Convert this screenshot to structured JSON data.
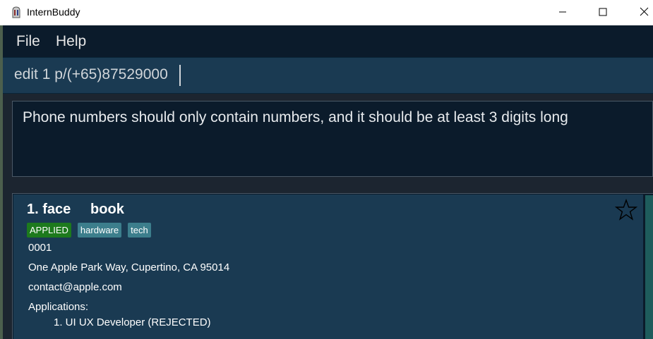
{
  "window": {
    "title": "InternBuddy"
  },
  "menu": {
    "items": [
      "File",
      "Help"
    ]
  },
  "command_box": {
    "value": "edit 1 p/(+65)87529000"
  },
  "result_display": {
    "message": "Phone numbers should only contain numbers, and it should be at least 3 digits long"
  },
  "list": {
    "cards": [
      {
        "index_title": "1. face     book",
        "tags": [
          {
            "label": "APPLIED",
            "kind": "status",
            "color": "#1d7a1d"
          },
          {
            "label": "hardware",
            "kind": "plain",
            "color": "#3c7e8c"
          },
          {
            "label": "tech",
            "kind": "plain",
            "color": "#3c7e8c"
          }
        ],
        "phone": "0001",
        "address": "One Apple Park Way, Cupertino, CA 95014",
        "email": "contact@apple.com",
        "applications_label": "Applications:",
        "applications": [
          "1. UI UX Developer (REJECTED)"
        ],
        "favourite_icon": "star-outline-icon"
      }
    ]
  },
  "colors": {
    "menu_bg": "#0b1b2b",
    "command_bg": "#1a3a52",
    "card_bg": "#1a3a52",
    "accent_green": "#1d7a1d",
    "tag_teal": "#3c7e8c"
  }
}
